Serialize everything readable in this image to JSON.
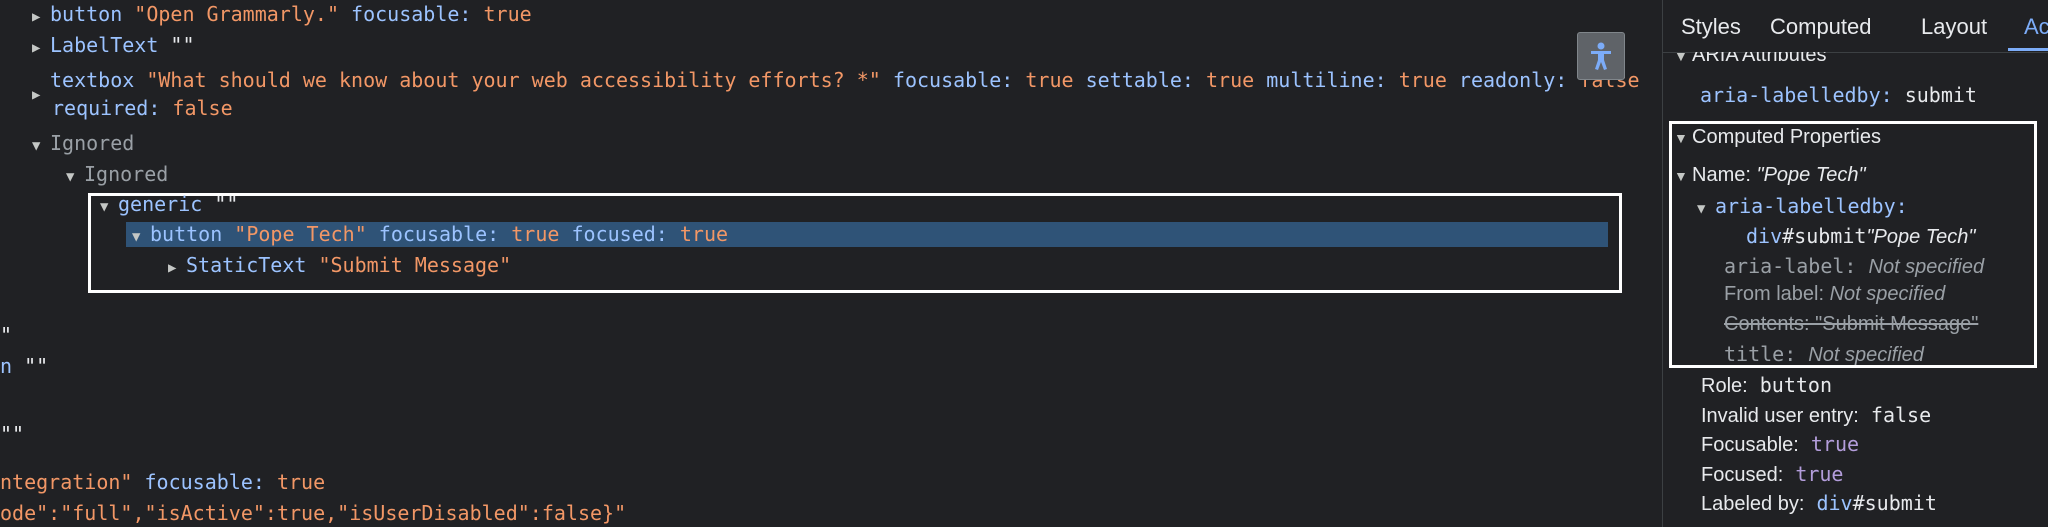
{
  "tree": {
    "line1": {
      "role": "button",
      "name": "\"Open Grammarly.\"",
      "k1": "focusable:",
      "v1": "true"
    },
    "line2": {
      "role": "LabelText",
      "name": "\"\""
    },
    "line3": {
      "role": "textbox",
      "name": "\"What should we know about your web accessibility efforts? *\"",
      "k1": "focusable:",
      "v1": "true",
      "k2": "settable:",
      "v2": "true",
      "k3": "multiline:",
      "v3": "true",
      "k4": "readonly:",
      "v4": "false"
    },
    "line3b": {
      "k5": "required:",
      "v5": "false"
    },
    "line4": {
      "label": "Ignored"
    },
    "line5": {
      "label": "Ignored"
    },
    "line6": {
      "role": "generic",
      "name": "\"\""
    },
    "line7": {
      "role": "button",
      "name": "\"Pope Tech\"",
      "k1": "focusable:",
      "v1": "true",
      "k2": "focused:",
      "v2": "true"
    },
    "line8": {
      "role": "StaticText",
      "name": "\"Submit Message\""
    },
    "frag1": "\"",
    "frag2a": "n",
    "frag2b": "\"\"",
    "frag3": "\"\"",
    "frag4a": "ntegration\"",
    "frag4k": "focusable:",
    "frag4v": "true",
    "frag5": "ode\":\"full\",\"isActive\":true,\"isUserDisabled\":false}\""
  },
  "tabs": [
    "Styles",
    "Computed",
    "Layout",
    "Ac"
  ],
  "panel": {
    "aria_header": "ARIA Attributes",
    "aria_labelledby_key": "aria-labelledby:",
    "aria_labelledby_val": "submit",
    "computed_header": "Computed Properties",
    "name_label": "Name:",
    "name_value": "\"Pope Tech\"",
    "labelledby_key": "aria-labelledby:",
    "div_tag": "div",
    "div_id": "#submit",
    "div_name": "\"Pope Tech\"",
    "aria_label_key": "aria-label:",
    "aria_label_val": "Not specified",
    "from_label_key": "From label:",
    "from_label_val": "Not specified",
    "contents": "Contents: \"Submit Message\"",
    "title_key": "title:",
    "title_val": "Not specified",
    "role_key": "Role:",
    "role_val": "button",
    "invalid_key": "Invalid user entry:",
    "invalid_val": "false",
    "focusable_key": "Focusable:",
    "focusable_val": "true",
    "focused_key": "Focused:",
    "focused_val": "true",
    "labeled_key": "Labeled by:",
    "labeled_tag": "div",
    "labeled_id": "#submit"
  }
}
